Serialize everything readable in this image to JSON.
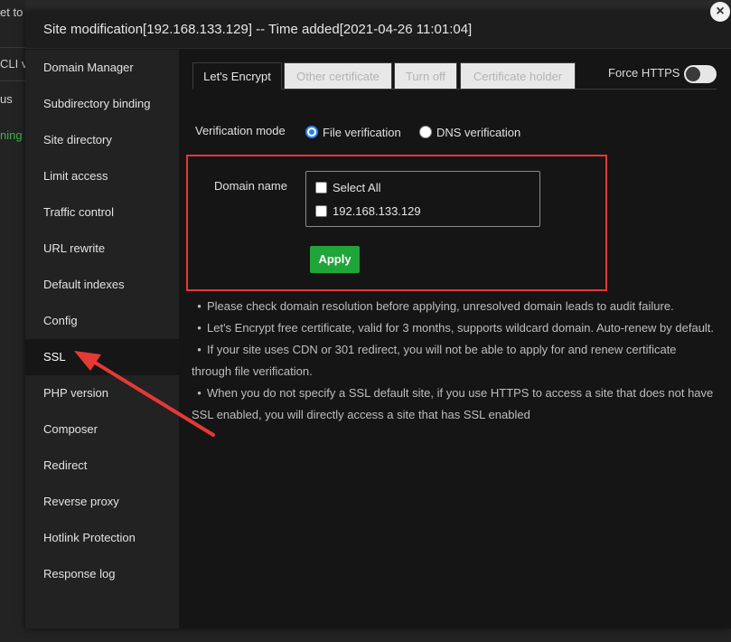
{
  "background": {
    "row0": "et to",
    "row1": "CLI v",
    "row2": "us",
    "row3": "ning"
  },
  "modal": {
    "title": "Site modification[192.168.133.129] -- Time added[2021-04-26 11:01:04]",
    "close_icon": "×"
  },
  "sidebar": {
    "active_index": 8,
    "items": [
      {
        "label": "Domain Manager"
      },
      {
        "label": "Subdirectory binding"
      },
      {
        "label": "Site directory"
      },
      {
        "label": "Limit access"
      },
      {
        "label": "Traffic control"
      },
      {
        "label": "URL rewrite"
      },
      {
        "label": "Default indexes"
      },
      {
        "label": "Config"
      },
      {
        "label": "SSL"
      },
      {
        "label": "PHP version"
      },
      {
        "label": "Composer"
      },
      {
        "label": "Redirect"
      },
      {
        "label": "Reverse proxy"
      },
      {
        "label": "Hotlink Protection"
      },
      {
        "label": "Response log"
      }
    ]
  },
  "tabs": [
    {
      "label": "Let's Encrypt",
      "active": true
    },
    {
      "label": "Other certificate",
      "active": false
    },
    {
      "label": "Turn off",
      "active": false
    },
    {
      "label": "Certificate holder",
      "active": false
    }
  ],
  "force_https": {
    "label": "Force HTTPS",
    "enabled": false
  },
  "verification": {
    "label": "Verification mode",
    "options": [
      {
        "label": "File verification",
        "selected": true
      },
      {
        "label": "DNS verification",
        "selected": false
      }
    ]
  },
  "domain": {
    "label": "Domain name",
    "options": [
      {
        "label": "Select All",
        "checked": false
      },
      {
        "label": "192.168.133.129",
        "checked": false
      }
    ]
  },
  "apply_label": "Apply",
  "notes": [
    "Please check domain resolution before applying, unresolved domain leads to audit failure.",
    "Let's Encrypt free certificate, valid for 3 months, supports wildcard domain. Auto-renew by default.",
    "If your site uses CDN or 301 redirect, you will not be able to apply for and renew certificate through file verification.",
    "When you do not specify a SSL default site, if you use HTTPS to access a site that does not have SSL enabled, you will directly access a site that has SSL enabled"
  ],
  "colors": {
    "accent_green": "#20a53a",
    "radio_blue": "#2a82e4",
    "highlight_red": "#e53935"
  }
}
